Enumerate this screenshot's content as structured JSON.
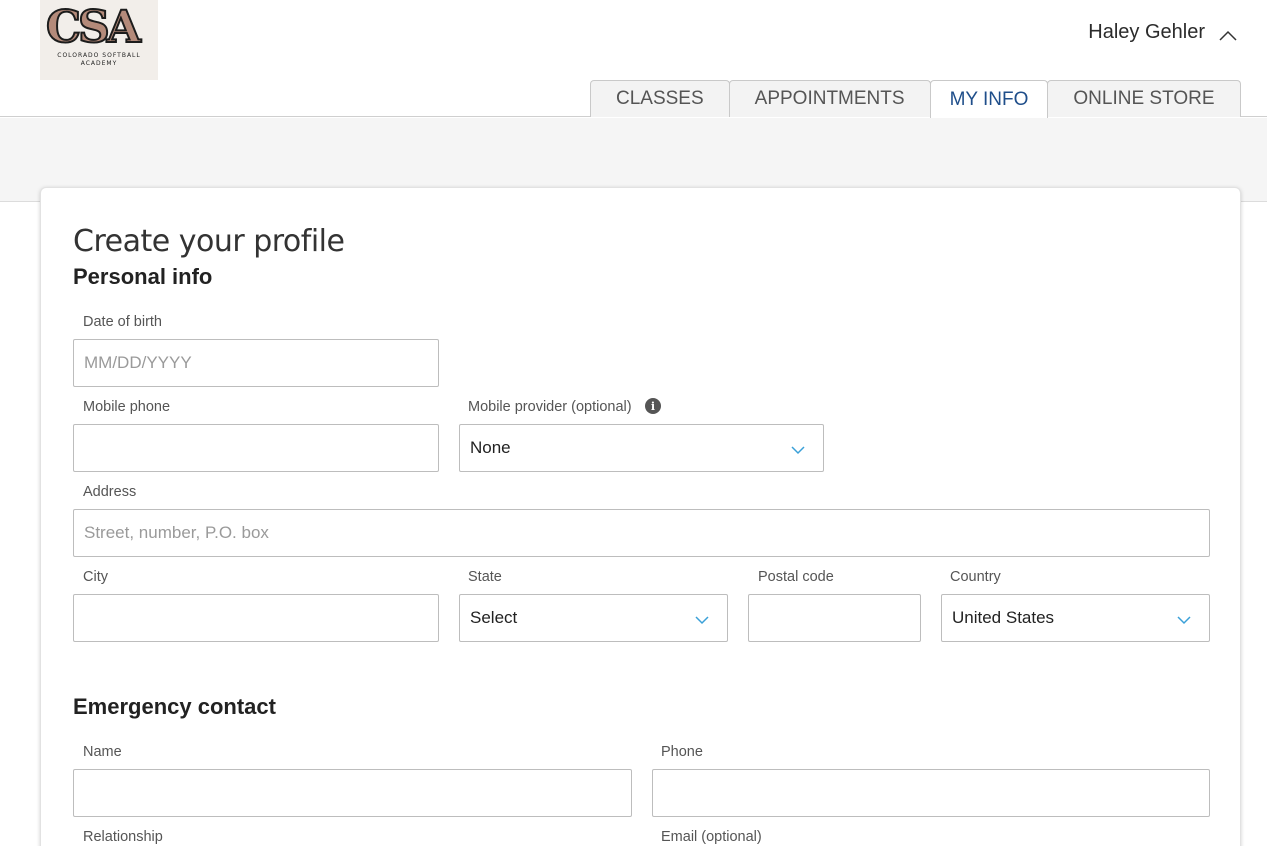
{
  "logo": {
    "mark": "CSA",
    "line1": "COLORADO SOFTBALL",
    "line2": "ACADEMY"
  },
  "user": {
    "name": "Haley Gehler"
  },
  "tabs": [
    {
      "label": "CLASSES"
    },
    {
      "label": "APPOINTMENTS"
    },
    {
      "label": "MY INFO"
    },
    {
      "label": "ONLINE STORE"
    }
  ],
  "active_tab": "MY INFO",
  "colors": {
    "accent": "#1f4e8a",
    "chevron": "#3aa0d8"
  },
  "form": {
    "title": "Create your profile",
    "personal": {
      "heading": "Personal info",
      "dob": {
        "label": "Date of birth",
        "placeholder": "MM/DD/YYYY",
        "value": ""
      },
      "mobile_phone": {
        "label": "Mobile phone",
        "value": ""
      },
      "mobile_provider": {
        "label": "Mobile provider (optional)",
        "value": "None"
      },
      "address": {
        "label": "Address",
        "placeholder": "Street, number, P.O. box",
        "value": ""
      },
      "city": {
        "label": "City",
        "value": ""
      },
      "state": {
        "label": "State",
        "value": "Select"
      },
      "postal_code": {
        "label": "Postal code",
        "value": ""
      },
      "country": {
        "label": "Country",
        "value": "United States"
      }
    },
    "emergency": {
      "heading": "Emergency contact",
      "name": {
        "label": "Name",
        "value": ""
      },
      "phone": {
        "label": "Phone",
        "value": ""
      },
      "relationship": {
        "label": "Relationship"
      },
      "email": {
        "label": "Email (optional)"
      }
    }
  }
}
